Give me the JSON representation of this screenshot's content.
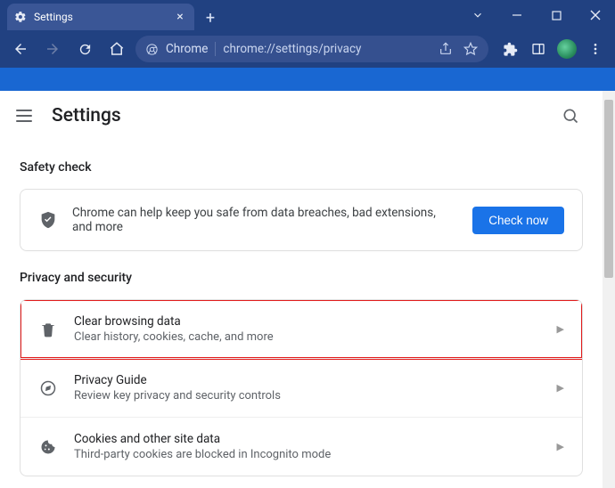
{
  "window": {
    "tab_title": "Settings",
    "address_chip": "Chrome",
    "url": "chrome://settings/privacy"
  },
  "page": {
    "title": "Settings"
  },
  "safety": {
    "section_label": "Safety check",
    "text": "Chrome can help keep you safe from data breaches, bad extensions, and more",
    "button": "Check now"
  },
  "privacy": {
    "section_label": "Privacy and security",
    "items": [
      {
        "title": "Clear browsing data",
        "sub": "Clear history, cookies, cache, and more"
      },
      {
        "title": "Privacy Guide",
        "sub": "Review key privacy and security controls"
      },
      {
        "title": "Cookies and other site data",
        "sub": "Third-party cookies are blocked in Incognito mode"
      }
    ]
  }
}
